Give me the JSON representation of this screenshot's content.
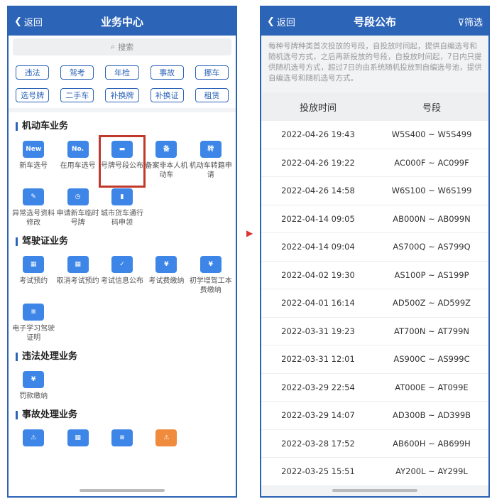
{
  "left": {
    "back": "返回",
    "title": "业务中心",
    "search_placeholder": "搜索",
    "tags": [
      "违法",
      "驾考",
      "年检",
      "事故",
      "挪车",
      "选号牌",
      "二手车",
      "补换牌",
      "补换证",
      "租赁"
    ],
    "sections": [
      {
        "title": "机动车业务",
        "items": [
          {
            "label": "新车选号",
            "icon": "new-plate-icon",
            "glyph": "New"
          },
          {
            "label": "在用车选号",
            "icon": "no-plate-icon",
            "glyph": "No."
          },
          {
            "label": "号牌号段公布",
            "icon": "notice-board-icon",
            "glyph": "▬",
            "highlight": true
          },
          {
            "label": "备案非本人机动车",
            "icon": "shield-icon",
            "glyph": "备"
          },
          {
            "label": "机动车转籍申请",
            "icon": "truck-transfer-icon",
            "glyph": "转"
          },
          {
            "label": "异常选号资料修改",
            "icon": "edit-plate-icon",
            "glyph": "✎"
          },
          {
            "label": "申请新车临时号牌",
            "icon": "clock-plate-icon",
            "glyph": "◷"
          },
          {
            "label": "城市货车通行码申领",
            "icon": "truck-icon",
            "glyph": "▮"
          }
        ]
      },
      {
        "title": "驾驶证业务",
        "items": [
          {
            "label": "考试预约",
            "icon": "calendar-icon",
            "glyph": "▦"
          },
          {
            "label": "取消考试预约",
            "icon": "calendar-cancel-icon",
            "glyph": "▦"
          },
          {
            "label": "考试信息公布",
            "icon": "exam-notice-icon",
            "glyph": "✓"
          },
          {
            "label": "考试费缴纳",
            "icon": "fee-icon",
            "glyph": "¥"
          },
          {
            "label": "初学增驾工本费缴纳",
            "icon": "fee-card-icon",
            "glyph": "¥"
          },
          {
            "label": "电子学习驾驶证明",
            "icon": "e-learning-icon",
            "glyph": "≡"
          }
        ]
      },
      {
        "title": "违法处理业务",
        "items": [
          {
            "label": "罚款缴纳",
            "icon": "fine-icon",
            "glyph": "¥"
          }
        ]
      },
      {
        "title": "事故处理业务",
        "items": [
          {
            "label": "",
            "icon": "accident-icon",
            "glyph": "⚠"
          },
          {
            "label": "",
            "icon": "accident-calendar-icon",
            "glyph": "▦"
          },
          {
            "label": "",
            "icon": "accident-report-icon",
            "glyph": "≡"
          },
          {
            "label": "",
            "icon": "accident-car-icon",
            "glyph": "⚠"
          }
        ]
      }
    ]
  },
  "right": {
    "back": "返回",
    "title": "号段公布",
    "filter": "筛选",
    "description": "每种号牌种类首次投放的号段，自投放时间起，提供自编选号和随机选号方式，之后再新投放的号段，自投放时间起，7日内只提供随机选号方式，超过7日的由系统随机投放到自编选号池，提供自编选号和随机选号方式。",
    "columns": [
      "投放时间",
      "号段"
    ],
    "rows": [
      [
        "2022-04-26 19:43",
        "W5S400 ~ W5S499"
      ],
      [
        "2022-04-26 19:22",
        "AC000F ~ AC099F"
      ],
      [
        "2022-04-26 14:58",
        "W6S100 ~ W6S199"
      ],
      [
        "2022-04-14 09:05",
        "AB000N ~ AB099N"
      ],
      [
        "2022-04-14 09:04",
        "AS700Q ~ AS799Q"
      ],
      [
        "2022-04-02 19:30",
        "AS100P ~ AS199P"
      ],
      [
        "2022-04-01 16:14",
        "AD500Z ~ AD599Z"
      ],
      [
        "2022-03-31 19:23",
        "AT700N ~ AT799N"
      ],
      [
        "2022-03-31 12:01",
        "AS900C ~ AS999C"
      ],
      [
        "2022-03-29 22:54",
        "AT000E ~ AT099E"
      ],
      [
        "2022-03-29 14:07",
        "AD300B ~ AD399B"
      ],
      [
        "2022-03-28 17:52",
        "AB600H ~ AB699H"
      ],
      [
        "2022-03-25 15:51",
        "AY200L ~ AY299L"
      ]
    ]
  },
  "colors": {
    "brand": "#2c64b8",
    "highlight": "#c0392b"
  }
}
